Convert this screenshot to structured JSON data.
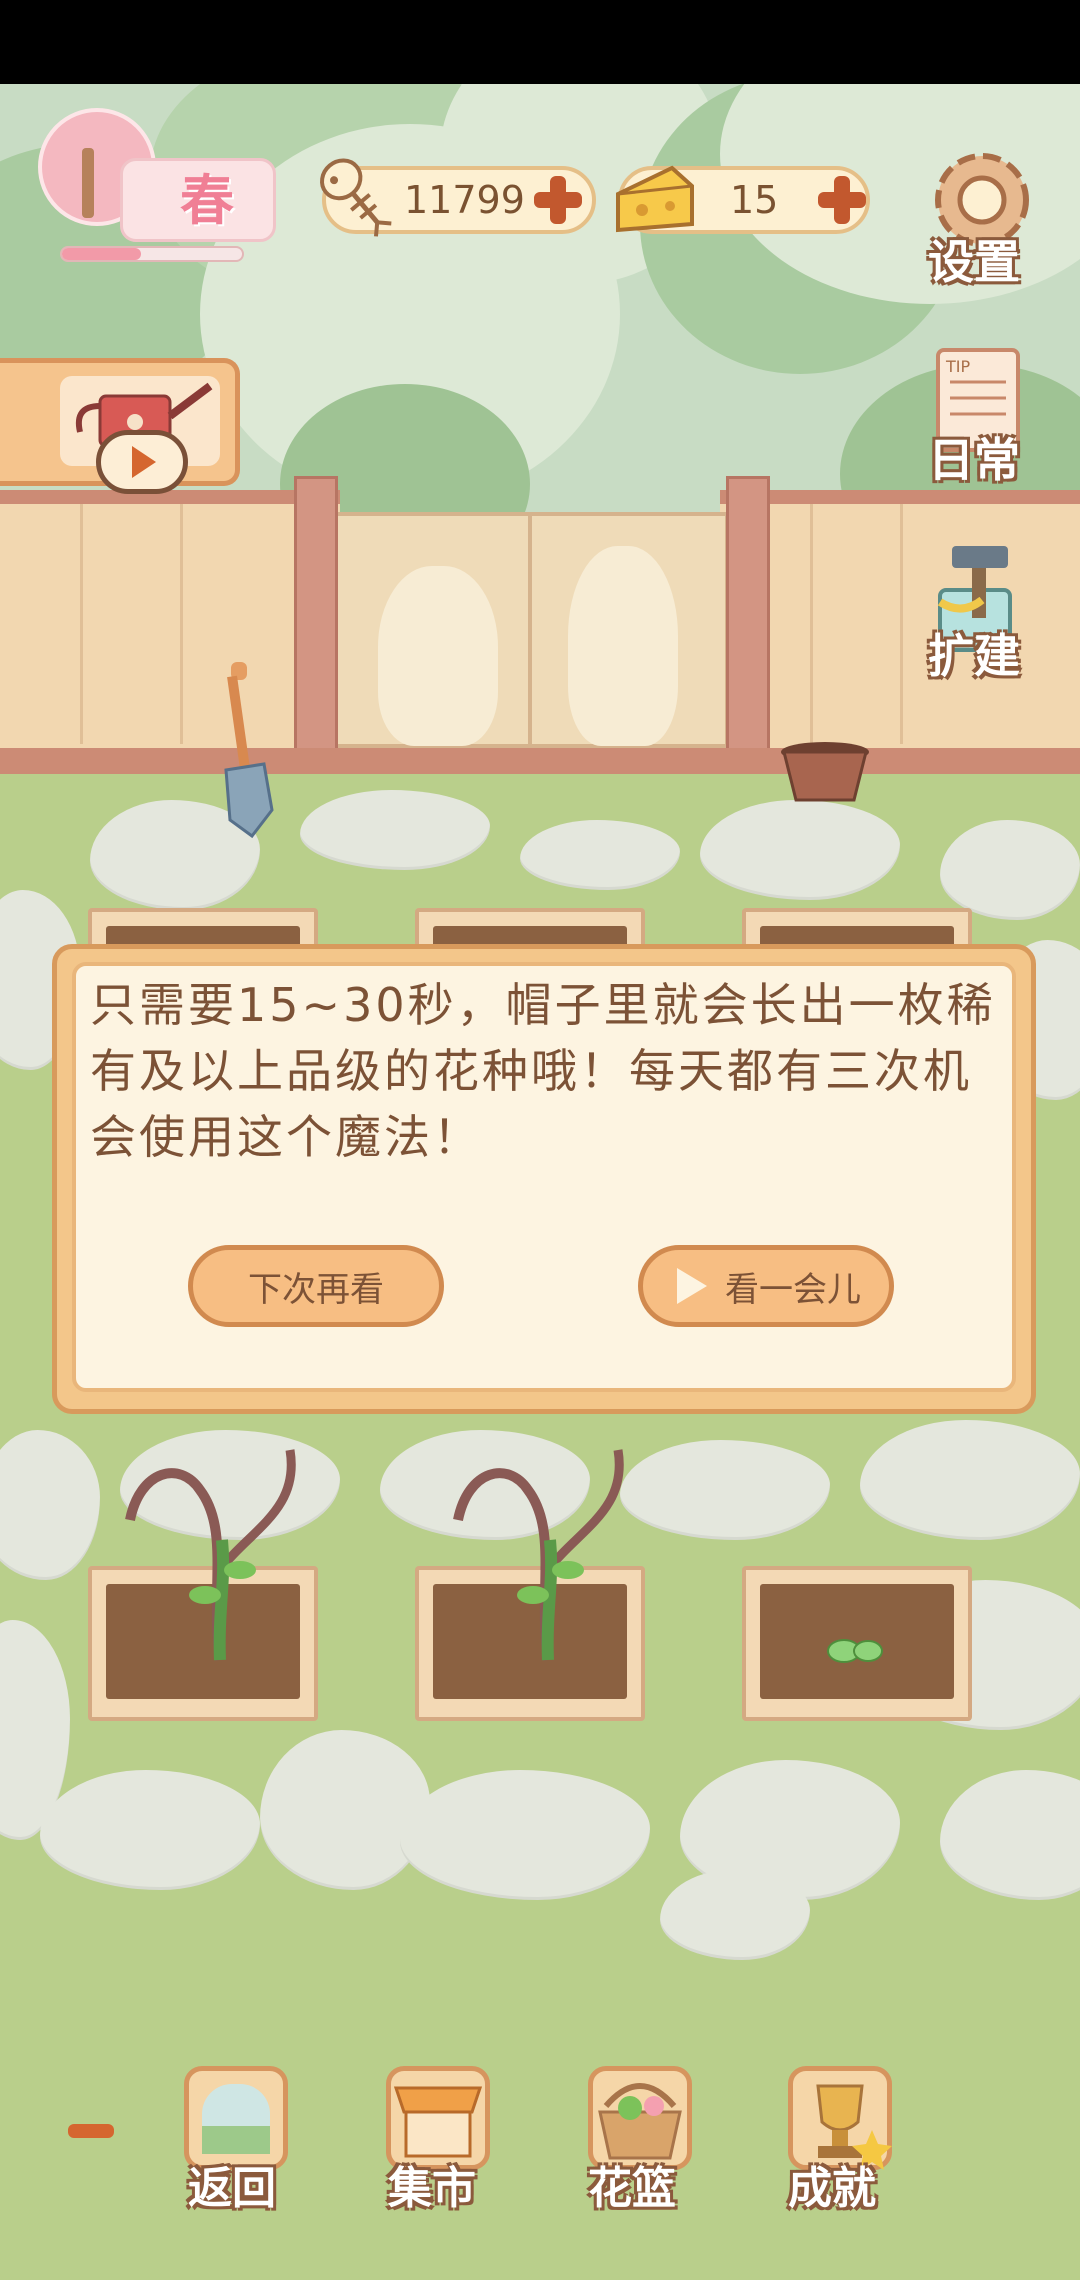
{
  "hud": {
    "season": "春",
    "season_progress": 0.45,
    "fish_bones": "11799",
    "cheese": "15"
  },
  "side_menu": {
    "settings": "设置",
    "daily": "日常",
    "expand": "扩建"
  },
  "dialog": {
    "message": "只需要15~30秒，帽子里就会长出一枚稀有及以上品级的花种哦！每天都有三次机会使用这个魔法！",
    "later_button": "下次再看",
    "watch_button": "看一会儿"
  },
  "bottom_nav": {
    "back": "返回",
    "market": "集市",
    "basket": "花篮",
    "achievements": "成就"
  },
  "colors": {
    "accent": "#d89a5c",
    "text_brown": "#7c5236",
    "sky": "#c8dcc4",
    "grass": "#b9cf8b"
  },
  "icons": [
    "fish-bone-icon",
    "cheese-icon",
    "plus-icon",
    "gear-icon",
    "tip-paper-icon",
    "hammer-paint-icon",
    "watering-can-icon",
    "play-icon",
    "shovel-icon",
    "flower-pot-icon",
    "window-icon",
    "market-stall-icon",
    "basket-icon",
    "trophy-icon"
  ]
}
